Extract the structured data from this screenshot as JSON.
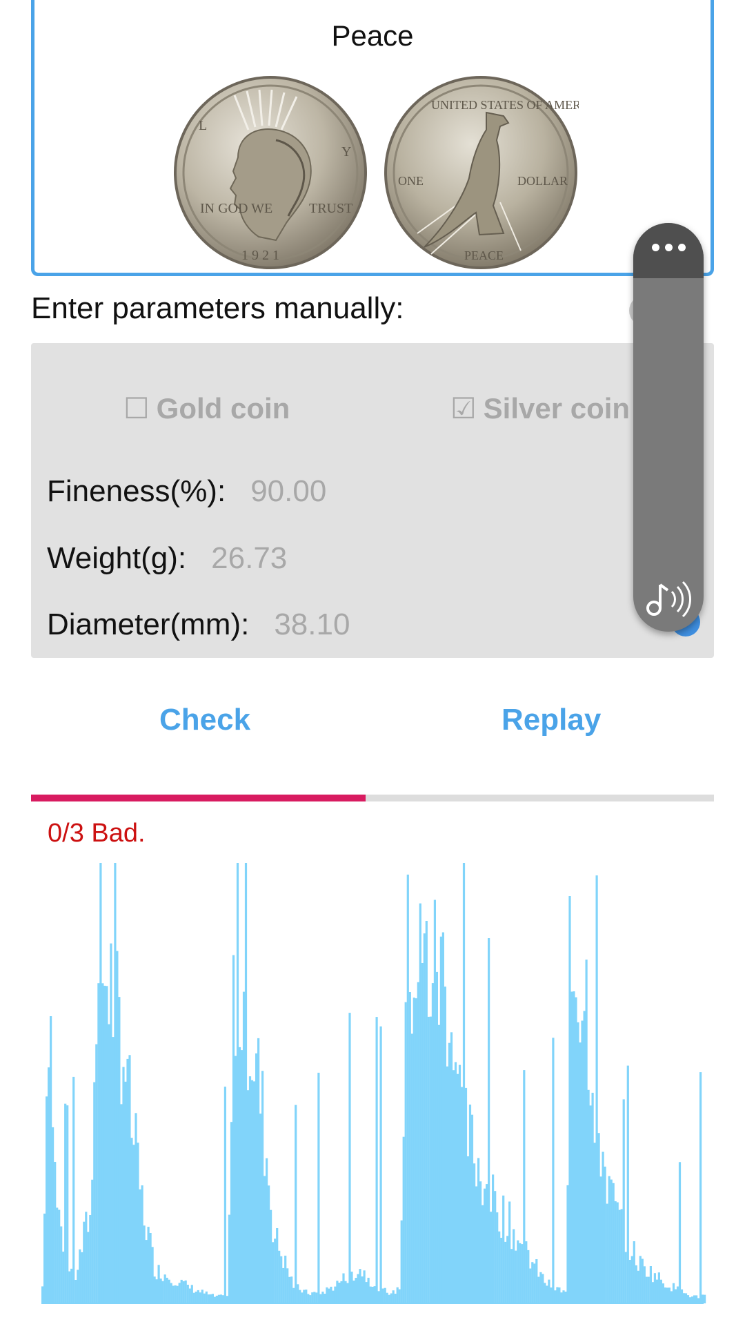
{
  "coin": {
    "title": "Peace",
    "obverse_image": "peace-dollar-obverse",
    "reverse_image": "peace-dollar-reverse"
  },
  "manual": {
    "label": "Enter parameters manually:"
  },
  "params": {
    "gold_label": "Gold coin",
    "gold_checked": false,
    "silver_label": "Silver coin",
    "silver_checked": true,
    "fineness_label": "Fineness(%):",
    "fineness_value": "90.00",
    "weight_label": "Weight(g):",
    "weight_value": "26.73",
    "diameter_label": "Diameter(mm):",
    "diameter_value": "38.10"
  },
  "actions": {
    "check_label": "Check",
    "replay_label": "Replay"
  },
  "progress": {
    "fraction": 0.49
  },
  "status": {
    "text": "0/3 Bad."
  },
  "floating_widget": {
    "menu_icon": "more-dots-icon",
    "bottom_icon": "sound-wave-icon"
  },
  "colors": {
    "accent": "#4aa3e8",
    "progress": "#d81b60",
    "bad": "#cc1111",
    "wave": "#81d4fa"
  },
  "chart_data": {
    "type": "area",
    "title": "",
    "xlabel": "",
    "ylabel": "",
    "ylim": [
      0,
      1
    ],
    "envelope": [
      [
        0,
        0.05
      ],
      [
        0.01,
        0.97
      ],
      [
        0.02,
        0.3
      ],
      [
        0.04,
        0.1
      ],
      [
        0.05,
        0.08
      ],
      [
        0.075,
        0.3
      ],
      [
        0.08,
        1.0
      ],
      [
        0.1,
        0.95
      ],
      [
        0.12,
        0.8
      ],
      [
        0.13,
        0.6
      ],
      [
        0.15,
        0.3
      ],
      [
        0.17,
        0.1
      ],
      [
        0.2,
        0.07
      ],
      [
        0.23,
        0.04
      ],
      [
        0.245,
        0.03
      ],
      [
        0.26,
        0.02
      ],
      [
        0.28,
        0.02
      ],
      [
        0.29,
        0.99
      ],
      [
        0.31,
        0.86
      ],
      [
        0.33,
        0.6
      ],
      [
        0.35,
        0.2
      ],
      [
        0.37,
        0.1
      ],
      [
        0.38,
        0.05
      ],
      [
        0.4,
        0.03
      ],
      [
        0.42,
        0.03
      ],
      [
        0.44,
        0.05
      ],
      [
        0.46,
        0.08
      ],
      [
        0.48,
        0.1
      ],
      [
        0.5,
        0.06
      ],
      [
        0.51,
        0.04
      ],
      [
        0.53,
        0.03
      ],
      [
        0.54,
        0.05
      ],
      [
        0.55,
        1.0
      ],
      [
        0.57,
        0.99
      ],
      [
        0.6,
        0.97
      ],
      [
        0.61,
        0.95
      ],
      [
        0.63,
        0.6
      ],
      [
        0.64,
        0.5
      ],
      [
        0.66,
        0.4
      ],
      [
        0.68,
        0.3
      ],
      [
        0.7,
        0.25
      ],
      [
        0.72,
        0.18
      ],
      [
        0.74,
        0.12
      ],
      [
        0.76,
        0.06
      ],
      [
        0.78,
        0.04
      ],
      [
        0.79,
        0.03
      ],
      [
        0.8,
        0.99
      ],
      [
        0.82,
        0.94
      ],
      [
        0.83,
        0.7
      ],
      [
        0.84,
        0.5
      ],
      [
        0.86,
        0.3
      ],
      [
        0.88,
        0.2
      ],
      [
        0.9,
        0.12
      ],
      [
        0.92,
        0.09
      ],
      [
        0.94,
        0.06
      ],
      [
        0.96,
        0.04
      ],
      [
        0.98,
        0.02
      ],
      [
        1.0,
        0.02
      ]
    ]
  }
}
